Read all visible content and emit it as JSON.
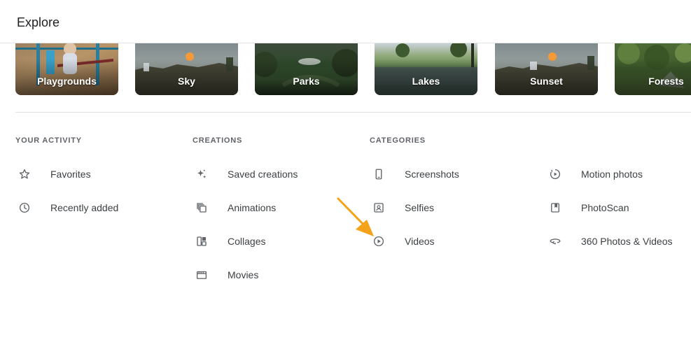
{
  "page": {
    "title": "Explore"
  },
  "tiles": [
    {
      "label": "Playgrounds",
      "icon": "playground-photo"
    },
    {
      "label": "Sky",
      "icon": "sky-photo"
    },
    {
      "label": "Parks",
      "icon": "park-photo"
    },
    {
      "label": "Lakes",
      "icon": "lake-photo"
    },
    {
      "label": "Sunset",
      "icon": "sunset-photo"
    },
    {
      "label": "Forests",
      "icon": "forest-photo"
    }
  ],
  "sections": {
    "activity": {
      "title": "YOUR ACTIVITY",
      "items": [
        {
          "label": "Favorites",
          "icon": "star-icon"
        },
        {
          "label": "Recently added",
          "icon": "clock-icon"
        }
      ]
    },
    "creations": {
      "title": "CREATIONS",
      "items": [
        {
          "label": "Saved creations",
          "icon": "sparkle-icon"
        },
        {
          "label": "Animations",
          "icon": "animation-icon"
        },
        {
          "label": "Collages",
          "icon": "collage-icon"
        },
        {
          "label": "Movies",
          "icon": "movie-icon"
        }
      ]
    },
    "categories": {
      "title": "CATEGORIES",
      "items": [
        {
          "label": "Screenshots",
          "icon": "phone-icon"
        },
        {
          "label": "Selfies",
          "icon": "selfie-icon"
        },
        {
          "label": "Videos",
          "icon": "play-circle-icon"
        },
        {
          "label": "Motion photos",
          "icon": "motion-photo-icon"
        },
        {
          "label": "PhotoScan",
          "icon": "photoscan-icon"
        },
        {
          "label": "360 Photos & Videos",
          "icon": "panorama-360-icon"
        }
      ]
    }
  },
  "annotation": {
    "arrow_color": "#f4a21a",
    "icon": "pointer-arrow"
  },
  "colors": {
    "text": "#3c4043",
    "muted": "#5f6368",
    "divider": "#e0e0e0"
  }
}
